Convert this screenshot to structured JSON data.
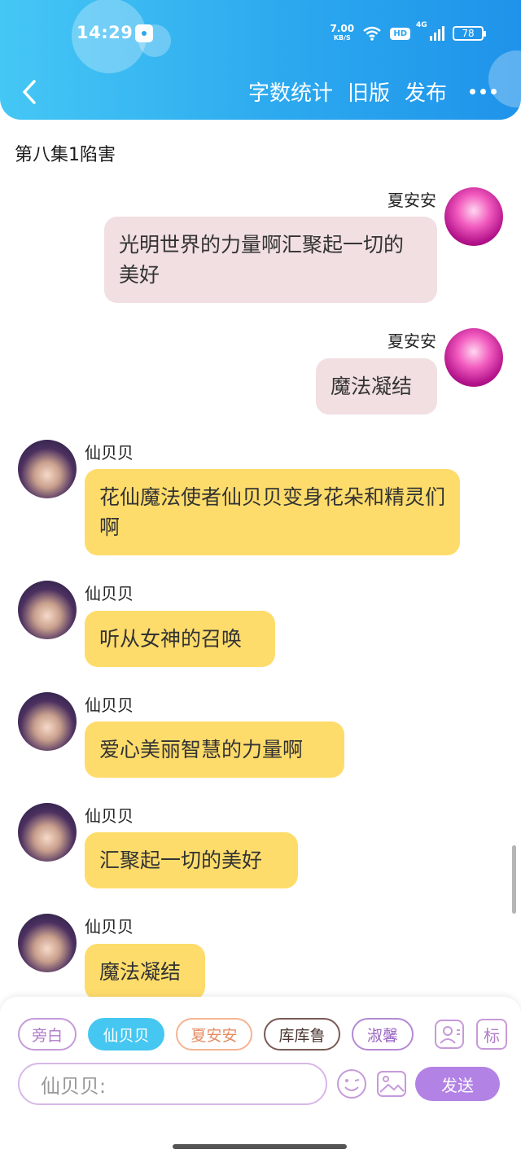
{
  "status_bar": {
    "time": "14:29",
    "net_speed_value": "7.00",
    "net_speed_unit": "KB/S",
    "hd_label": "HD",
    "network_label": "4G",
    "battery": "78"
  },
  "header": {
    "actions": [
      "字数统计",
      "旧版",
      "发布"
    ]
  },
  "episode_title": "第八集1陷害",
  "messages": [
    {
      "speaker": "夏安安",
      "text": "光明世界的力量啊汇聚起一切的美好",
      "side": "right"
    },
    {
      "speaker": "夏安安",
      "text": "魔法凝结",
      "side": "right"
    },
    {
      "speaker": "仙贝贝",
      "text": "花仙魔法使者仙贝贝变身花朵和精灵们啊",
      "side": "left"
    },
    {
      "speaker": "仙贝贝",
      "text": "听从女神的召唤",
      "side": "left"
    },
    {
      "speaker": "仙贝贝",
      "text": "爱心美丽智慧的力量啊",
      "side": "left"
    },
    {
      "speaker": "仙贝贝",
      "text": "汇聚起一切的美好",
      "side": "left"
    },
    {
      "speaker": "仙贝贝",
      "text": "魔法凝结",
      "side": "left"
    }
  ],
  "roles": [
    "旁白",
    "仙贝贝",
    "夏安安",
    "库库鲁",
    "淑馨"
  ],
  "active_role": "仙贝贝",
  "tag_label": "标",
  "input": {
    "placeholder": "仙贝贝:"
  },
  "send_label": "发送",
  "colors": {
    "header_gradient_start": "#45c7f5",
    "header_gradient_end": "#1f93ea",
    "bubble_pink": "#f2dfe1",
    "bubble_yellow": "#fedc6b",
    "active_chip": "#46c7f1",
    "send_button": "#b282e5"
  }
}
